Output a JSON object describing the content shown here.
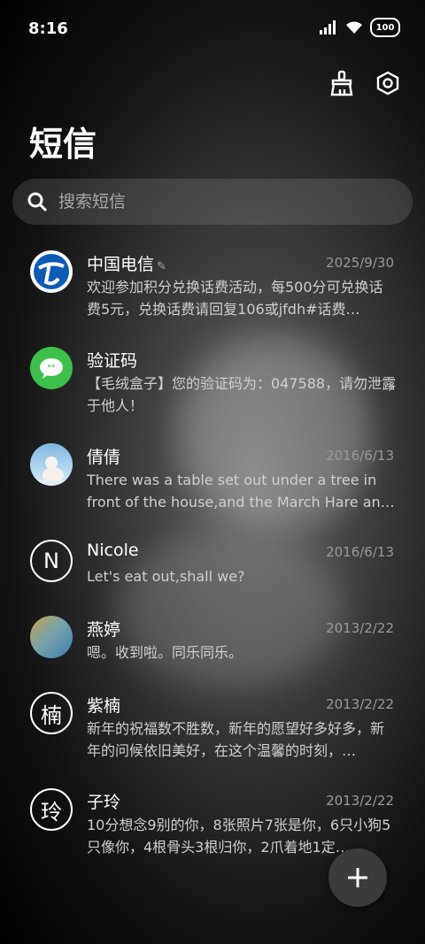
{
  "status": {
    "time": "8:16",
    "battery": "100"
  },
  "header": {
    "title": "短信"
  },
  "search": {
    "placeholder": "搜索短信"
  },
  "conversations": [
    {
      "name": "中国电信",
      "date": "2025/9/30",
      "preview": "欢迎参加积分兑换话费活动，每500分可兑换话费5元，兑换话费请回复106或jfdh#话费…",
      "avatar": "china-telecom-logo"
    },
    {
      "name": "验证码",
      "date": "",
      "preview": "【毛绒盒子】您的验证码为：047588，请勿泄露于他人！",
      "avatar": "message-bubble"
    },
    {
      "name": "倩倩",
      "date": "2016/6/13",
      "preview": "There was a table set out under a tree in front of the house,and the March Hare an…",
      "avatar": "polar-bear-photo"
    },
    {
      "name": "Nicole",
      "date": "2016/6/13",
      "preview": "Let's eat out,shall we?",
      "avatar_letter": "N"
    },
    {
      "name": "燕婷",
      "date": "2013/2/22",
      "preview": "嗯。收到啦。同乐同乐。",
      "avatar": "landscape-photo"
    },
    {
      "name": "紫楠",
      "date": "2013/2/22",
      "preview": "新年的祝福数不胜数，新年的愿望好多好多，新年的问候依旧美好，在这个温馨的时刻，…",
      "avatar_letter": "楠"
    },
    {
      "name": "子玲",
      "date": "2013/2/22",
      "preview": "10分想念9别的你，8张照片7张是你，6只小狗5只像你，4根骨头3根归你，2爪着地1定…",
      "avatar_letter": "玲"
    }
  ],
  "fab": {
    "label": "+"
  }
}
